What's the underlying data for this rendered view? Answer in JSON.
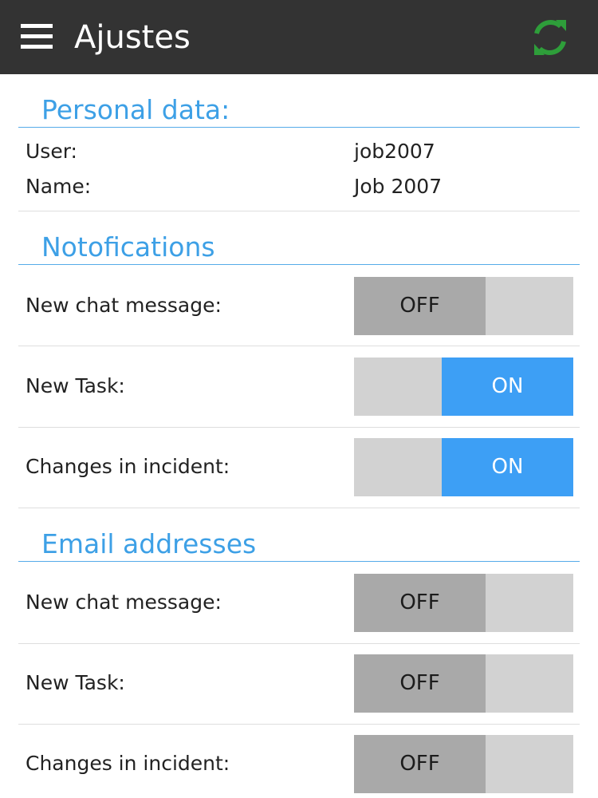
{
  "header": {
    "title": "Ajustes",
    "menu_icon": "hamburger-menu-icon",
    "refresh_icon": "refresh-icon",
    "refresh_color": "#2e9e3a",
    "background": "#333333"
  },
  "personal": {
    "title": "Personal data:",
    "user_label": "User:",
    "user_value": "job2007",
    "name_label": "Name:",
    "name_value": "Job 2007"
  },
  "notifications": {
    "title": "Notofications",
    "items": [
      {
        "label": "New chat message:",
        "state": "OFF"
      },
      {
        "label": "New Task:",
        "state": "ON"
      },
      {
        "label": "Changes in incident:",
        "state": "ON"
      }
    ]
  },
  "email": {
    "title": "Email addresses",
    "items": [
      {
        "label": "New chat message:",
        "state": "OFF"
      },
      {
        "label": "New Task:",
        "state": "OFF"
      },
      {
        "label": "Changes in incident:",
        "state": "OFF"
      }
    ]
  },
  "colors": {
    "accent": "#3da0e6",
    "toggle_on": "#3d9ff5",
    "toggle_off_knob": "#a9a9a9",
    "toggle_track": "#d2d2d2"
  }
}
